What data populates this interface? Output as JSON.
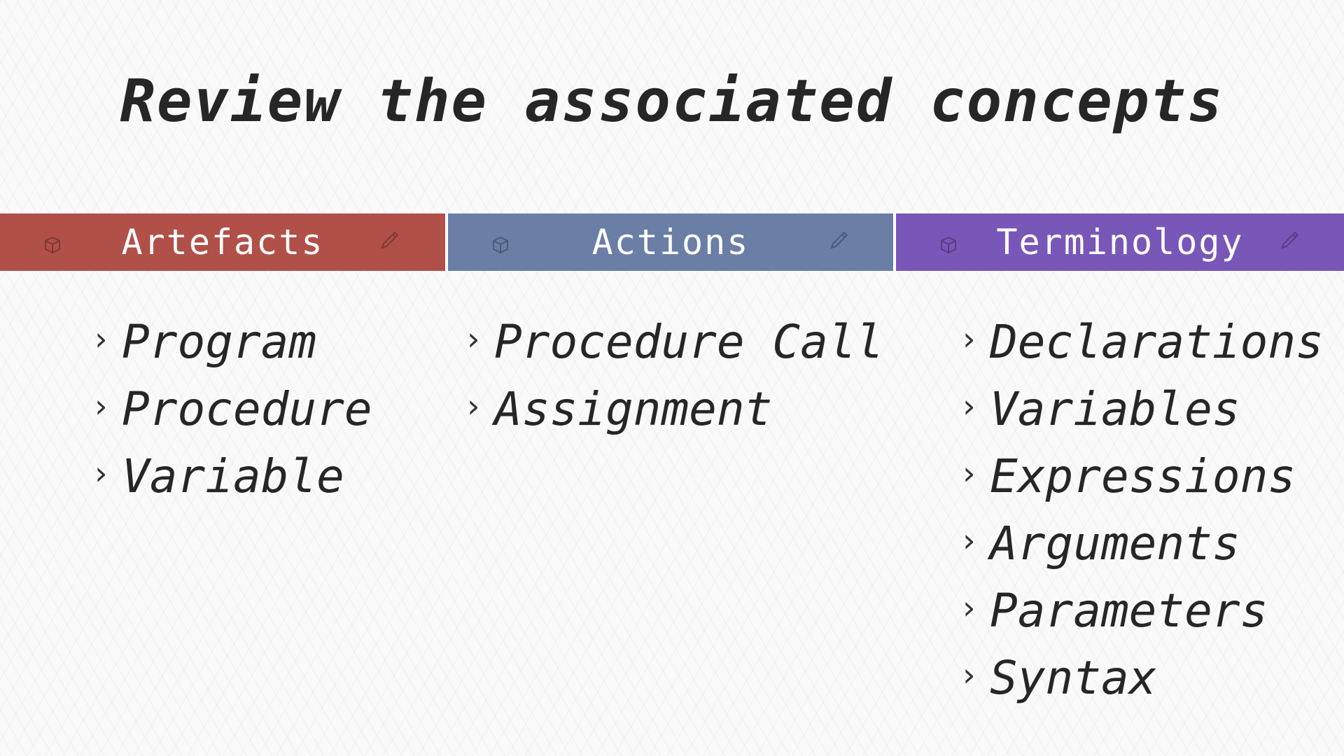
{
  "slide": {
    "title": "Review the associated concepts"
  },
  "header": {
    "cells": [
      {
        "label": "Artefacts",
        "color": "#b05049"
      },
      {
        "label": "Actions",
        "color": "#6a7ea6"
      },
      {
        "label": "Terminology",
        "color": "#7857b8"
      }
    ]
  },
  "columns": {
    "artefacts": {
      "items": [
        "Program",
        "Procedure",
        "Variable"
      ]
    },
    "actions": {
      "items": [
        "Procedure Call",
        "Assignment"
      ]
    },
    "terminology": {
      "items": [
        "Declarations",
        "Variables",
        "Expressions",
        "Arguments",
        "Parameters",
        "Syntax"
      ]
    }
  },
  "icons": {
    "bullet": "chevron-right-icon",
    "decoration_left": "cube-icon",
    "decoration_right": "pencil-icon"
  }
}
